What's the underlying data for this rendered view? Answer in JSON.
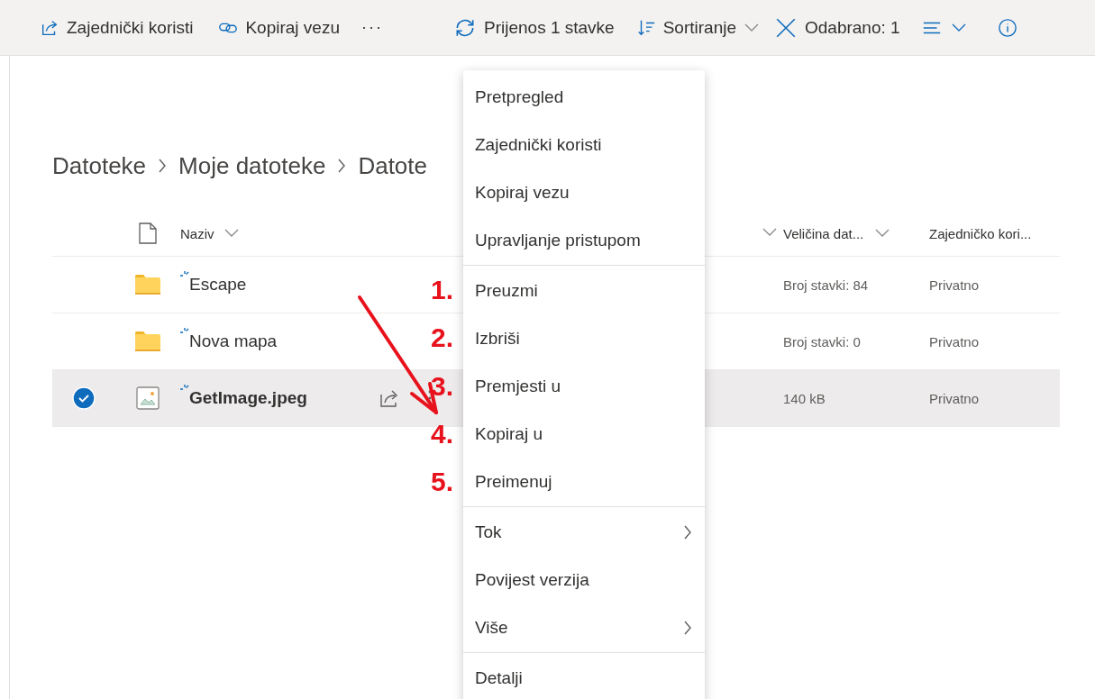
{
  "toolbar": [
    {
      "kind": "share",
      "label": "Zajednički koristi"
    },
    {
      "kind": "link",
      "label": "Kopiraj vezu"
    },
    {
      "kind": "more",
      "label": "···"
    },
    {
      "kind": "sync",
      "label": "Prijenos 1 stavke"
    },
    {
      "kind": "sort",
      "label": "Sortiranje"
    },
    {
      "kind": "clear",
      "label": "Odabrano: 1"
    },
    {
      "kind": "view"
    },
    {
      "kind": "info"
    }
  ],
  "breadcrumb": [
    "Datoteke",
    "Moje datoteke",
    "Datote"
  ],
  "table": {
    "columns": [
      {
        "label": "Naziv"
      },
      {},
      {
        "label": "Veličina dat..."
      },
      {
        "label": "Zajedničko kori..."
      }
    ],
    "rows": [
      {
        "kind": "folder",
        "name": "Escape",
        "size": "Broj stavki: 84",
        "sharing": "Privatno",
        "selected": false
      },
      {
        "kind": "folder",
        "name": "Nova mapa",
        "size": "Broj stavki: 0",
        "sharing": "Privatno",
        "selected": false
      },
      {
        "kind": "image",
        "name": "GetImage.jpeg",
        "size": "140 kB",
        "sharing": "Privatno",
        "selected": true
      }
    ]
  },
  "context_menu": [
    [
      {
        "label": "Pretpregled",
        "submenu": false
      },
      {
        "label": "Zajednički koristi",
        "submenu": false
      },
      {
        "label": "Kopiraj vezu",
        "submenu": false
      },
      {
        "label": "Upravljanje pristupom",
        "submenu": false
      }
    ],
    [
      {
        "label": "Preuzmi",
        "submenu": false
      },
      {
        "label": "Izbriši",
        "submenu": false
      },
      {
        "label": "Premjesti u",
        "submenu": false
      },
      {
        "label": "Kopiraj u",
        "submenu": false
      },
      {
        "label": "Preimenuj",
        "submenu": false
      }
    ],
    [
      {
        "label": "Tok",
        "submenu": true
      },
      {
        "label": "Povijest verzija",
        "submenu": false
      },
      {
        "label": "Više",
        "submenu": true
      }
    ],
    [
      {
        "label": "Detalji",
        "submenu": false
      }
    ]
  ],
  "annotations": [
    "1.",
    "2.",
    "3.",
    "4.",
    "5."
  ]
}
